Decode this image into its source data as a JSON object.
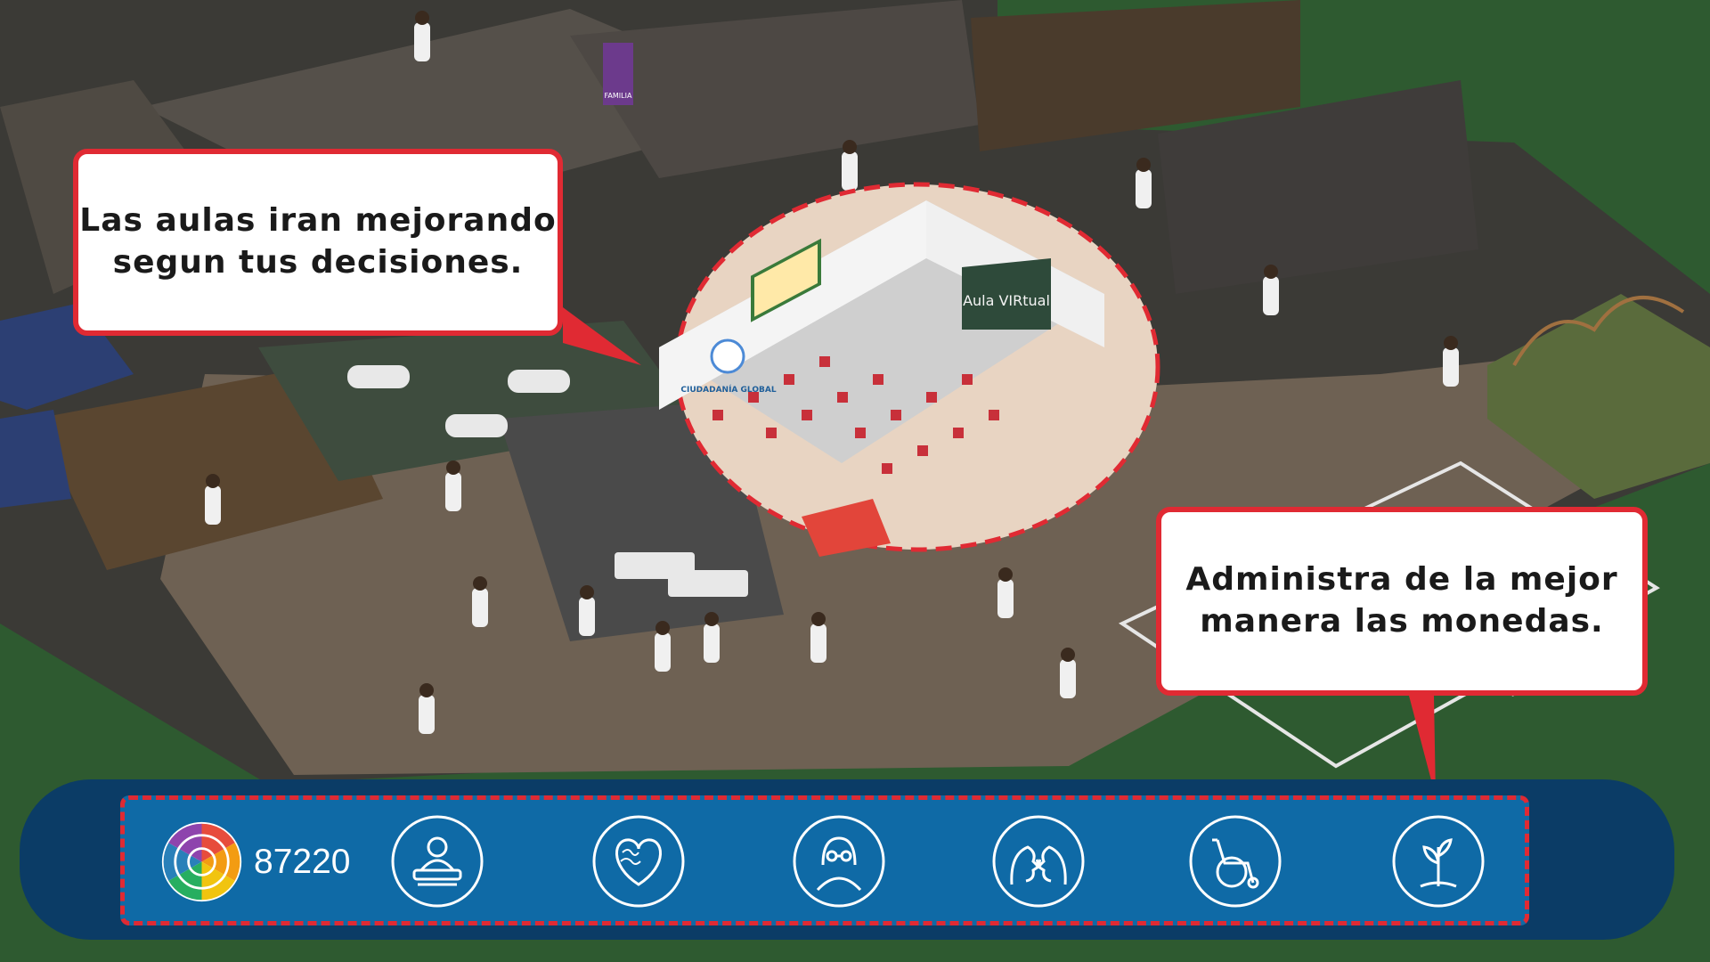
{
  "callouts": {
    "classrooms_text": "Las aulas iran mejorando\nsegun tus decisiones.",
    "coins_text": "Administra de la mejor\nmanera las monedas."
  },
  "hud": {
    "coins": "87220",
    "buttons": [
      {
        "icon": "student-desk-icon"
      },
      {
        "icon": "brain-heart-icon"
      },
      {
        "icon": "person-glasses-icon"
      },
      {
        "icon": "two-faces-communication-icon"
      },
      {
        "icon": "wheelchair-icon"
      },
      {
        "icon": "sprout-icon"
      }
    ]
  },
  "scene": {
    "classroom_board_text": "Aula VIRtual",
    "classroom_banner_text": "CIUDADANÍA GLOBAL",
    "poster_text": "FAMILIA"
  },
  "colors": {
    "accent_red": "#e02a33",
    "hud_dark": "#0b3c66",
    "hud_blue": "#0f6aa6",
    "grass": "#2f5a2f"
  }
}
